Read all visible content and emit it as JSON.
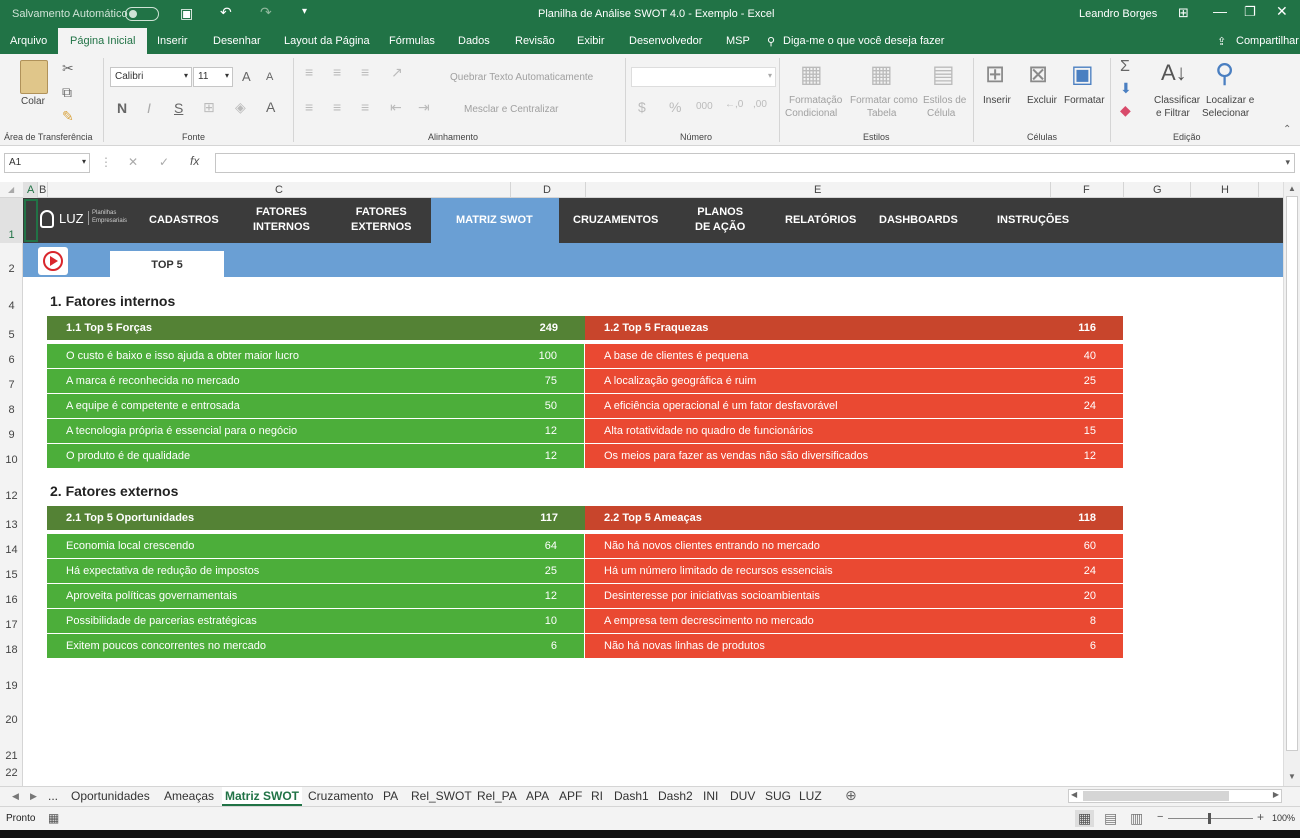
{
  "window": {
    "autosave_label": "Salvamento Automático",
    "title": "Planilha de Análise SWOT 4.0 - Exemplo  -  Excel",
    "user": "Leandro Borges"
  },
  "ribbon_tabs": [
    "Arquivo",
    "Página Inicial",
    "Inserir",
    "Desenhar",
    "Layout da Página",
    "Fórmulas",
    "Dados",
    "Revisão",
    "Exibir",
    "Desenvolvedor",
    "MSP"
  ],
  "tell_me": "Diga-me o que você deseja fazer",
  "share": "Compartilhar",
  "ribbon": {
    "paste": "Colar",
    "clipboard": "Área de Transferência",
    "font_name": "Calibri",
    "font_size": "11",
    "font_group": "Fonte",
    "wrap_text": "Quebrar Texto Automaticamente",
    "merge_center": "Mesclar e Centralizar",
    "alignment_group": "Alinhamento",
    "number_group": "Número",
    "cond_format_1": "Formatação",
    "cond_format_2": "Condicional",
    "format_table_1": "Formatar como",
    "format_table_2": "Tabela",
    "cell_styles_1": "Estilos de",
    "cell_styles_2": "Célula",
    "styles_group": "Estilos",
    "insert": "Inserir",
    "delete": "Excluir",
    "format": "Formatar",
    "cells_group": "Células",
    "sort_1": "Classificar",
    "sort_2": "e Filtrar",
    "find_1": "Localizar e",
    "find_2": "Selecionar",
    "editing_group": "Edição",
    "bold": "N",
    "underline": "S",
    "font_color_glyph": "A"
  },
  "namebox": "A1",
  "formula_fx": "fx",
  "columns": [
    "A",
    "B",
    "C",
    "D",
    "E",
    "F",
    "G",
    "H"
  ],
  "rows": [
    "1",
    "2",
    "4",
    "5",
    "6",
    "7",
    "8",
    "9",
    "10",
    "12",
    "13",
    "14",
    "15",
    "16",
    "17",
    "18",
    "19",
    "20",
    "21",
    "22"
  ],
  "nav": {
    "logo": "LUZ",
    "logo_sub_1": "Planilhas",
    "logo_sub_2": "Empresariais",
    "items": [
      "CADASTROS",
      "FATORES\nINTERNOS",
      "FATORES\nEXTERNOS",
      "MATRIZ SWOT",
      "CRUZAMENTOS",
      "PLANOS\nDE AÇÃO",
      "RELATÓRIOS",
      "DASHBOARDS",
      "INSTRUÇÕES"
    ],
    "active": "MATRIZ SWOT",
    "subtab": "TOP 5"
  },
  "sections": {
    "internal": "1. Fatores internos",
    "external": "2. Fatores externos"
  },
  "tables": {
    "strengths": {
      "title": "1.1 Top 5 Forças",
      "total": "249",
      "rows": [
        [
          "O custo é baixo e isso ajuda a obter maior lucro",
          "100"
        ],
        [
          "A marca é reconhecida no mercado",
          "75"
        ],
        [
          "A equipe é competente e entrosada",
          "50"
        ],
        [
          "A tecnologia própria é essencial para o negócio",
          "12"
        ],
        [
          "O produto é de qualidade",
          "12"
        ]
      ]
    },
    "weaknesses": {
      "title": "1.2 Top 5 Fraquezas",
      "total": "116",
      "rows": [
        [
          "A base de clientes é pequena",
          "40"
        ],
        [
          "A localização geográfica é ruim",
          "25"
        ],
        [
          "A eficiência operacional é um fator desfavorável",
          "24"
        ],
        [
          "Alta rotatividade no quadro de funcionários",
          "15"
        ],
        [
          "Os meios para fazer as vendas não são diversificados",
          "12"
        ]
      ]
    },
    "opportunities": {
      "title": "2.1 Top 5 Oportunidades",
      "total": "117",
      "rows": [
        [
          "Economia local crescendo",
          "64"
        ],
        [
          "Há expectativa de redução de impostos",
          "25"
        ],
        [
          "Aproveita políticas governamentais",
          "12"
        ],
        [
          "Possibilidade de parcerias estratégicas",
          "10"
        ],
        [
          "Exitem poucos concorrentes no mercado",
          "6"
        ]
      ]
    },
    "threats": {
      "title": "2.2 Top 5 Ameaças",
      "total": "118",
      "rows": [
        [
          "Não há novos clientes entrando no mercado",
          "60"
        ],
        [
          "Há um número limitado de recursos essenciais",
          "24"
        ],
        [
          "Desinteresse por iniciativas socioambientais",
          "20"
        ],
        [
          "A empresa tem decrescimento no mercado",
          "8"
        ],
        [
          "Não há novas linhas de produtos",
          "6"
        ]
      ]
    }
  },
  "colors": {
    "green_header": "#548235",
    "green_row": "#4cae3a",
    "red_header": "#c8452c",
    "red_row": "#ea4932",
    "nav_dark": "#3b3b3b",
    "nav_active": "#6a9fd4",
    "excel_green": "#217346"
  },
  "sheet_tabs": [
    "...",
    "Oportunidades",
    "Ameaças",
    "Matriz SWOT",
    "Cruzamento",
    "PA",
    "Rel_SWOT",
    "Rel_PA",
    "APA",
    "APF",
    "RI",
    "Dash1",
    "Dash2",
    "INI",
    "DUV",
    "SUG",
    "LUZ"
  ],
  "active_sheet": "Matriz SWOT",
  "status": "Pronto",
  "zoom": "100%"
}
